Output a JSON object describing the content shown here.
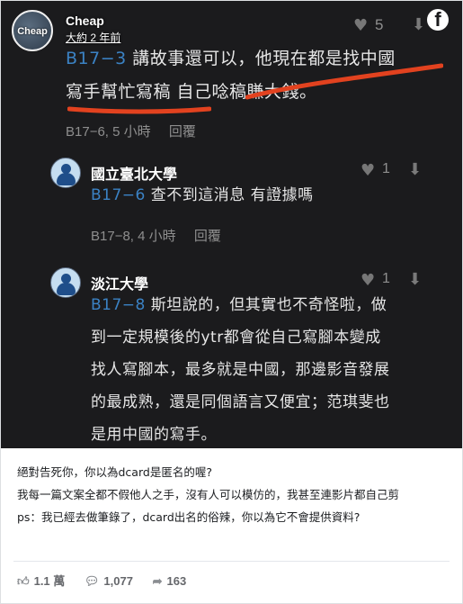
{
  "page": {
    "name": "Cheap",
    "avatar_text": "Cheap",
    "time": "大約 2 年前",
    "fb_glyph": "f"
  },
  "screenshot": {
    "top_likes": "5",
    "comment1": {
      "ref": "B17−3",
      "text_line1": " 講故事還可以，他現在都是找中國",
      "text_line2": "寫手幫忙寫稿 自己唸稿賺大錢。",
      "floor": "B17−6, 5 小時",
      "reply_label": "回覆"
    },
    "reply1": {
      "school": "國立臺北大學",
      "likes": "1",
      "ref": "B17−6",
      "text": " 查不到這消息 有證據嗎",
      "floor": "B17−8, 4 小時",
      "reply_label": "回覆"
    },
    "reply2": {
      "school": "淡江大學",
      "likes": "1",
      "ref": "B17−8",
      "lines": [
        " 斯坦說的，但其實也不奇怪啦，做",
        "到一定規模後的ytr都會從自己寫腳本變成",
        "找人寫腳本，最多就是中國，那邊影音發展",
        "的最成熟，還是同個語言又便宜；范琪斐也",
        "是用中國的寫手。"
      ]
    }
  },
  "caption": {
    "line1": "絕對告死你，你以為dcard是匿名的喔?",
    "line2": "我每一篇文案全都不假他人之手，沒有人可以模仿的，我甚至連影片都自己剪",
    "line3": "ps：我已經去做筆錄了，dcard出名的俗辣，你以為它不會提供資料?"
  },
  "stats": {
    "likes": "1.1 萬",
    "comments": "1,077",
    "shares": "163"
  },
  "colors": {
    "dark_bg": "#1b1b1d",
    "link_blue": "#3b82c4",
    "underline_red": "#e2421f"
  }
}
